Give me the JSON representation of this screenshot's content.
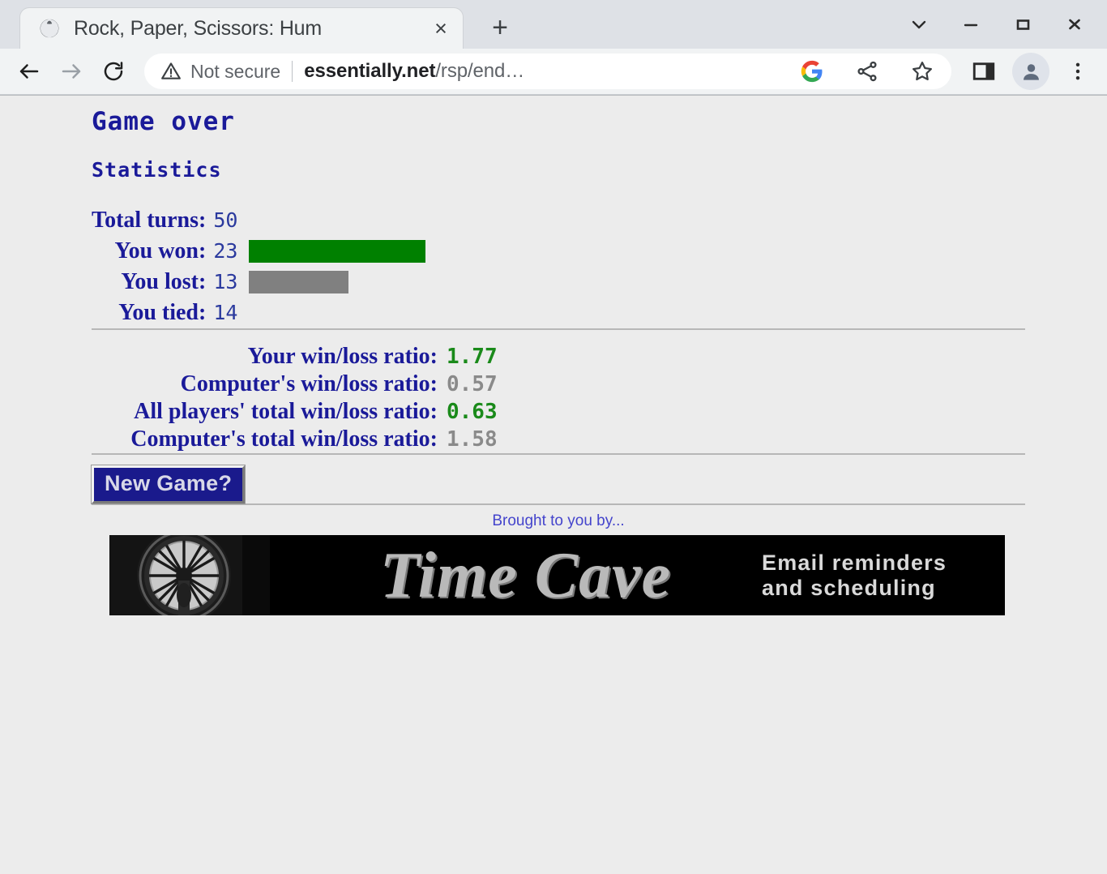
{
  "browser": {
    "tab": {
      "title": "Rock, Paper, Scissors: Hum",
      "favicon": "globe-icon",
      "close_label": "×"
    },
    "new_tab_label": "+",
    "window_controls": {
      "tab_search": "chevron-down-icon",
      "minimize": "minimize-icon",
      "maximize": "maximize-icon",
      "close": "close-icon"
    },
    "nav": {
      "back": "back-arrow-icon",
      "forward": "forward-arrow-icon",
      "reload": "reload-icon"
    },
    "omnibox": {
      "security_icon": "warning-triangle-icon",
      "security_label": "Not secure",
      "url_host": "essentially.net",
      "url_path": "/rsp/end…",
      "google_icon": "google-g-icon",
      "share_icon": "share-icon",
      "bookmark_icon": "star-icon"
    },
    "toolbar_tail": {
      "side_panel": "side-panel-icon",
      "profile": "profile-avatar-icon",
      "menu": "three-dot-menu-icon"
    }
  },
  "page": {
    "heading": "Game over",
    "subheading": "Statistics",
    "stats": [
      {
        "label": "Total turns:",
        "value": "50",
        "bar": null
      },
      {
        "label": "You won:",
        "value": "23",
        "bar": "win"
      },
      {
        "label": "You lost:",
        "value": "13",
        "bar": "loss"
      },
      {
        "label": "You tied:",
        "value": "14",
        "bar": null
      }
    ],
    "ratios": [
      {
        "label": "Your win/loss ratio:",
        "value": "1.77",
        "tone": "green"
      },
      {
        "label": "Computer's win/loss ratio:",
        "value": "0.57",
        "tone": "gray"
      },
      {
        "label": "All players' total win/loss ratio:",
        "value": "0.63",
        "tone": "green"
      },
      {
        "label": "Computer's total win/loss ratio:",
        "value": "1.58",
        "tone": "gray"
      }
    ],
    "new_game_label": "New Game?",
    "ad": {
      "caption": "Brought to you by...",
      "brand": "Time Cave",
      "tagline_line1": "Email reminders",
      "tagline_line2": "and scheduling",
      "image": "clock-tower-photo"
    }
  },
  "chart_data": {
    "type": "bar",
    "title": "Statistics",
    "categories": [
      "You won",
      "You lost"
    ],
    "values": [
      23,
      13
    ],
    "colors": [
      "#008000",
      "#808080"
    ],
    "xlabel": "",
    "ylabel": "",
    "total_turns": 50,
    "ties": 14,
    "bar_pixels_per_unit": 9.45,
    "grid": false,
    "legend": "none"
  },
  "colors": {
    "page_bg": "#ececec",
    "heading": "#1a1a99",
    "value_text": "#2b3a9e",
    "win_bar": "#008000",
    "loss_bar": "#808080",
    "ratio_green": "#1a8a1a",
    "ratio_gray": "#8a8a8a",
    "button_bg": "#1a1a8c",
    "button_text": "#d8d8e8",
    "ad_caption": "#4444cc",
    "banner_bg": "#000000"
  }
}
